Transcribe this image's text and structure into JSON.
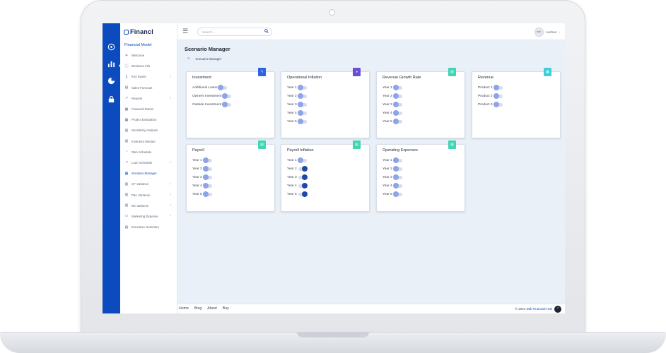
{
  "app": {
    "logo_text": "Financl",
    "model_title": "Financial Model"
  },
  "colors": {
    "primary": "#0b4bbd",
    "toggle_on": "#1d48a8",
    "toggle_off": "#8ea3e8",
    "badge_blue": "#2f63e0",
    "badge_purple": "#6a4fd6",
    "badge_teal": "#3fd6b2",
    "badge_cyan": "#3fcfd8"
  },
  "rail_icons": [
    "palette-icon",
    "bar-chart-icon",
    "pie-chart-icon",
    "lock-icon"
  ],
  "sidebar": {
    "items": [
      {
        "label": "Welcome",
        "icon": "rocket-icon",
        "glyph": "✈",
        "has_chevron": false,
        "active": false
      },
      {
        "label": "Business Info",
        "icon": "info-icon",
        "glyph": "ⓘ",
        "has_chevron": false,
        "active": false
      },
      {
        "label": "Key Inputs",
        "icon": "key-icon",
        "glyph": "⚷",
        "has_chevron": true,
        "active": false
      },
      {
        "label": "Sales Forecast",
        "icon": "list-icon",
        "glyph": "▤",
        "has_chevron": false,
        "active": false
      },
      {
        "label": "Reports",
        "icon": "trend-icon",
        "glyph": "↗",
        "has_chevron": true,
        "active": false
      },
      {
        "label": "Financial Ratios",
        "icon": "grid-icon",
        "glyph": "▦",
        "has_chevron": false,
        "active": false
      },
      {
        "label": "Project Evaluation",
        "icon": "grid-icon",
        "glyph": "▦",
        "has_chevron": false,
        "active": false
      },
      {
        "label": "Sensitivity Analysis",
        "icon": "table-icon",
        "glyph": "▥",
        "has_chevron": false,
        "active": false
      },
      {
        "label": "Inventory Module",
        "icon": "table-icon",
        "glyph": "▥",
        "has_chevron": false,
        "active": false
      },
      {
        "label": "D&A Schedule",
        "icon": "gauge-icon",
        "glyph": "◔",
        "has_chevron": false,
        "active": false
      },
      {
        "label": "Loan Schedule",
        "icon": "trend-icon",
        "glyph": "↗",
        "has_chevron": true,
        "active": false
      },
      {
        "label": "Scenario Manager",
        "icon": "grid-icon",
        "glyph": "▦",
        "has_chevron": false,
        "active": true
      },
      {
        "label": "CF Variance",
        "icon": "table-icon",
        "glyph": "▥",
        "has_chevron": true,
        "active": false
      },
      {
        "label": "P&L Variance",
        "icon": "table-icon",
        "glyph": "▥",
        "has_chevron": true,
        "active": false
      },
      {
        "label": "BS Variance",
        "icon": "table-icon",
        "glyph": "▥",
        "has_chevron": true,
        "active": false
      },
      {
        "label": "Marketing Expense",
        "icon": "monitor-icon",
        "glyph": "▭",
        "has_chevron": true,
        "active": false
      },
      {
        "label": "Executive Summary",
        "icon": "document-icon",
        "glyph": "▤",
        "has_chevron": false,
        "active": false
      }
    ]
  },
  "topbar": {
    "search_placeholder": "Search...",
    "user_name": "Anirban",
    "avatar_text": "Anir"
  },
  "page": {
    "title": "Scenario Manager",
    "breadcrumb": "Scenario Manager"
  },
  "cards": [
    {
      "title": "Investment",
      "badge_color": "#2f63e0",
      "badge_glyph": "↰",
      "badge_icon": "arrow-icon",
      "rows": [
        {
          "label": "Additional Loans",
          "on": false
        },
        {
          "label": "Owners Investment",
          "on": false
        },
        {
          "label": "Outside Investment",
          "on": false
        }
      ]
    },
    {
      "title": "Operational Inflation",
      "badge_color": "#6a4fd6",
      "badge_glyph": "◕",
      "badge_icon": "pie-icon",
      "rows": [
        {
          "label": "Year 1",
          "on": false
        },
        {
          "label": "Year 2",
          "on": false
        },
        {
          "label": "Year 3",
          "on": false
        },
        {
          "label": "Year 4",
          "on": false
        },
        {
          "label": "Year 5",
          "on": false
        }
      ]
    },
    {
      "title": "Revenue Growth Rate",
      "badge_color": "#3fd6b2",
      "badge_glyph": "▥",
      "badge_icon": "chart-icon",
      "rows": [
        {
          "label": "Year 1",
          "on": false
        },
        {
          "label": "Year 2",
          "on": false
        },
        {
          "label": "Year 3",
          "on": false
        },
        {
          "label": "Year 4",
          "on": false
        },
        {
          "label": "Year 5",
          "on": false
        }
      ]
    },
    {
      "title": "Revenue",
      "badge_color": "#3fcfd8",
      "badge_glyph": "▦",
      "badge_icon": "revenue-icon",
      "rows": [
        {
          "label": "Product 1",
          "on": false
        },
        {
          "label": "Product 2",
          "on": false
        },
        {
          "label": "Product 3",
          "on": false
        }
      ]
    },
    {
      "title": "Payroll",
      "badge_color": "#3fd6b2",
      "badge_glyph": "▥",
      "badge_icon": "payroll-icon",
      "rows": [
        {
          "label": "Year 1",
          "on": false
        },
        {
          "label": "Year 2",
          "on": false
        },
        {
          "label": "Year 3",
          "on": false
        },
        {
          "label": "Year 4",
          "on": false
        },
        {
          "label": "Year 5",
          "on": false
        }
      ]
    },
    {
      "title": "Payroll Inflation",
      "badge_color": "#3fd6b2",
      "badge_glyph": "▥",
      "badge_icon": "inflation-icon",
      "rows": [
        {
          "label": "Year 1",
          "on": false
        },
        {
          "label": "Year 2",
          "on": true
        },
        {
          "label": "Year 3",
          "on": true
        },
        {
          "label": "Year 4",
          "on": true
        },
        {
          "label": "Year 5",
          "on": true
        }
      ]
    },
    {
      "title": "Operating Expenses",
      "badge_color": "#3fd6b2",
      "badge_glyph": "▥",
      "badge_icon": "expense-icon",
      "rows": [
        {
          "label": "Year 1",
          "on": false
        },
        {
          "label": "Year 2",
          "on": false
        },
        {
          "label": "Year 3",
          "on": false
        },
        {
          "label": "Year 4",
          "on": false
        },
        {
          "label": "Year 5",
          "on": false
        }
      ]
    }
  ],
  "footer": {
    "links": [
      "Home",
      "Blog",
      "About",
      "Buy"
    ],
    "copyright_prefix": "© 2021",
    "copyright_brand": "Dali Financial Hub"
  }
}
